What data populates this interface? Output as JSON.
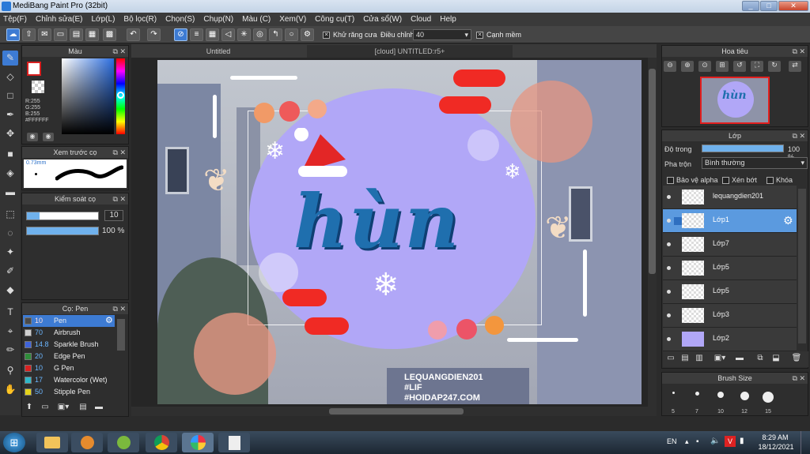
{
  "window": {
    "title": "MediBang Paint Pro (32bit)",
    "minimize": "_",
    "maximize": "□",
    "close": "✕"
  },
  "menu": [
    "Tệp(F)",
    "Chỉnh sửa(E)",
    "Lớp(L)",
    "Bộ lọc(R)",
    "Chọn(S)",
    "Chụp(N)",
    "Màu (C)",
    "Xem(V)",
    "Công cụ(T)",
    "Cửa sổ(W)",
    "Cloud",
    "Help"
  ],
  "toolbar": {
    "antialias_label": "Khử răng cưa",
    "correction_label": "Điều chỉnh",
    "correction_value": "40",
    "soft_edge_label": "Cạnh mềm"
  },
  "color_panel": {
    "title": "Màu",
    "r": "R:255",
    "g": "G:255",
    "b": "B:255",
    "hex": "#FFFFFF",
    "fg": "#ffffff",
    "bg": "#d81f1f"
  },
  "preview_panel": {
    "title": "Xem trước cọ",
    "size": "0.73mm"
  },
  "control_panel": {
    "title": "Kiểm soát cọ",
    "size_value": "10",
    "opacity_value": "100 %"
  },
  "brush_panel": {
    "title": "Cọ: Pen",
    "items": [
      {
        "num": "10",
        "name": "Pen",
        "color": "#4a4a4a"
      },
      {
        "num": "70",
        "name": "Airbrush",
        "color": "#cfcfcf"
      },
      {
        "num": "14.8",
        "name": "Sparkle Brush",
        "color": "#3f63d9"
      },
      {
        "num": "20",
        "name": "Edge Pen",
        "color": "#2f8c3a"
      },
      {
        "num": "10",
        "name": "G Pen",
        "color": "#d82121"
      },
      {
        "num": "17",
        "name": "Watercolor (Wet)",
        "color": "#2fb7c9"
      },
      {
        "num": "50",
        "name": "Stipple Pen",
        "color": "#e3d21b"
      }
    ]
  },
  "tabs": {
    "tab1": "Untitled",
    "tab2": "[cloud] UNTITLED:r5+"
  },
  "artwork": {
    "lettering": "hùn",
    "watermark1": "LEQUANGDIEN201",
    "watermark2": "#LIF",
    "watermark3": "#HOIDAP247.COM"
  },
  "navigator_panel": {
    "title": "Hoa tiêu"
  },
  "layer_panel": {
    "title": "Lớp",
    "opacity_label": "Độ trong",
    "opacity_value": "100 %",
    "blend_label": "Pha trộn",
    "blend_value": "Bình thường",
    "protect_alpha": "Bảo vệ alpha",
    "clip": "Xén bớt",
    "lock": "Khóa",
    "layers": [
      "lequangdien201",
      "Lớp1",
      "Lớp7",
      "Lớp5",
      "Lớp5",
      "Lớp3",
      "Lớp2"
    ]
  },
  "brush_size_panel": {
    "title": "Brush Size",
    "sizes": [
      "5",
      "7",
      "10",
      "12",
      "15"
    ]
  },
  "taskbar": {
    "lang": "EN",
    "time": "8:29 AM",
    "date": "18/12/2021"
  }
}
